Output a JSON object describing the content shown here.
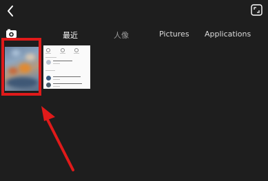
{
  "tabs": [
    {
      "label": "最近",
      "active": true
    },
    {
      "label": "人像",
      "active": false
    },
    {
      "label": "Pictures",
      "active": false
    },
    {
      "label": "Applications",
      "active": false
    }
  ],
  "icons": {
    "back": "chevron-left-icon",
    "expand": "fullscreen-icon",
    "album": "gallery-icon"
  },
  "annotation": {
    "color": "#e01a1a"
  },
  "thumbnails": [
    {
      "kind": "photo",
      "description_icon": "rainy-window-photo"
    },
    {
      "kind": "screenshot"
    }
  ]
}
